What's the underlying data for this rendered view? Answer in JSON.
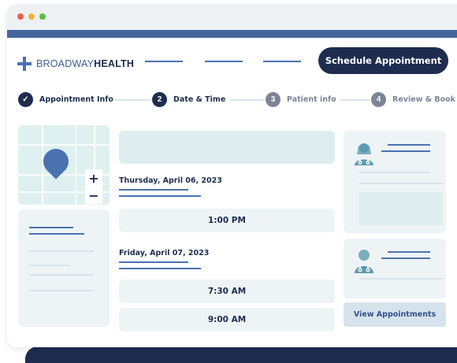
{
  "window": {
    "traffic_lights": [
      "#f05f4d",
      "#f3b737",
      "#55c240"
    ],
    "bar_color": "#45679e"
  },
  "header": {
    "logo_light": "BROADWAY",
    "logo_bold": "HEALTH",
    "cta_label": "Schedule Appointment"
  },
  "steps": [
    {
      "number": "✓",
      "label": "Appointment Info",
      "state": "completed"
    },
    {
      "number": "2",
      "label": "Date & Time",
      "state": "active"
    },
    {
      "number": "3",
      "label": "Patient info",
      "state": "pending"
    },
    {
      "number": "4",
      "label": "Review & Book",
      "state": "pending"
    }
  ],
  "map": {
    "zoom_in": "+",
    "zoom_out": "−"
  },
  "schedule": {
    "days": [
      {
        "date": "Thursday, April 06, 2023",
        "slots": [
          "1:00 PM"
        ]
      },
      {
        "date": "Friday, April 07, 2023",
        "slots": [
          "7:30 AM",
          "9:00 AM"
        ]
      }
    ]
  },
  "doctors_panel": {
    "icons": [
      "female-doctor-icon",
      "male-doctor-icon"
    ],
    "view_button": "View Appointments"
  },
  "colors": {
    "navy": "#1e2d4f",
    "accent_blue": "#4a72b0",
    "panel_bg": "#eef4f6",
    "map_bg": "#dff0f0",
    "muted_step": "#7b8596"
  }
}
